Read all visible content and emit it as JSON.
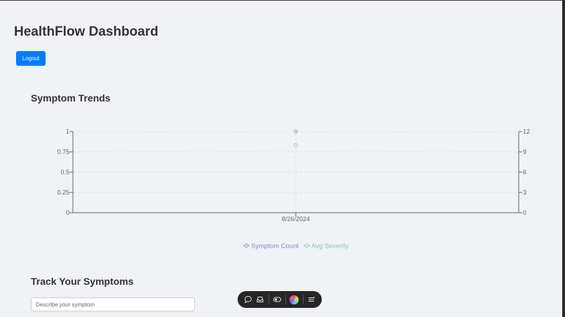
{
  "header": {
    "title": "HealthFlow Dashboard",
    "logout_label": "Logout"
  },
  "symptom_trends": {
    "title": "Symptom Trends"
  },
  "chart_data": {
    "type": "line",
    "x": [
      "8/26/2024"
    ],
    "y_left": {
      "ticks": [
        "0",
        "0.25",
        "0.5",
        "0.75",
        "1"
      ],
      "range": [
        0,
        1
      ]
    },
    "y_right": {
      "ticks": [
        "0",
        "3",
        "6",
        "9",
        "12"
      ],
      "range": [
        0,
        12
      ]
    },
    "series": [
      {
        "name": "Symptom Count",
        "axis": "right",
        "values": [
          12
        ],
        "color": "#8884d8"
      },
      {
        "name": "Avg Severity",
        "axis": "right",
        "values": [
          10
        ],
        "color": "#82ca9d"
      }
    ],
    "grid": true,
    "legend": "bottom"
  },
  "track": {
    "title": "Track Your Symptoms",
    "input_placeholder": "Describe your symptom"
  },
  "toolbar": {
    "icons": [
      "chat-icon",
      "inbox-icon",
      "toggle-icon",
      "color-orb-icon",
      "menu-icon"
    ]
  }
}
